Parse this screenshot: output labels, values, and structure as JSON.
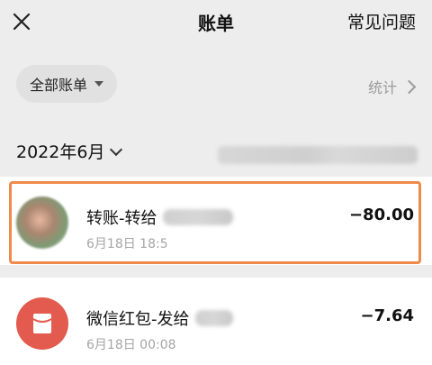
{
  "topbar": {
    "title": "账单",
    "faq_label": "常见问题"
  },
  "filter": {
    "pill_label": "全部账单",
    "stats_label": "统计"
  },
  "month": {
    "label": "2022年6月"
  },
  "transactions": [
    {
      "title": "转账-转给",
      "redacted_name": "",
      "time": "6月18日 18:5",
      "amount": "−80.00"
    },
    {
      "title": "微信红包-发给",
      "redacted_name": "",
      "time": "6月18日 00:08",
      "amount": "−7.64"
    }
  ],
  "colors": {
    "background": "#ededed",
    "item_bg": "#ffffff",
    "highlight": "#f08a4b",
    "red_packet": "#e25b4e",
    "muted_text": "#9a9a9a"
  },
  "icons": {
    "close": "close-icon",
    "dropdown": "caret-down-icon",
    "chevron_right": "chevron-right-icon",
    "chevron_down": "chevron-down-icon",
    "red_packet": "red-packet-icon"
  }
}
